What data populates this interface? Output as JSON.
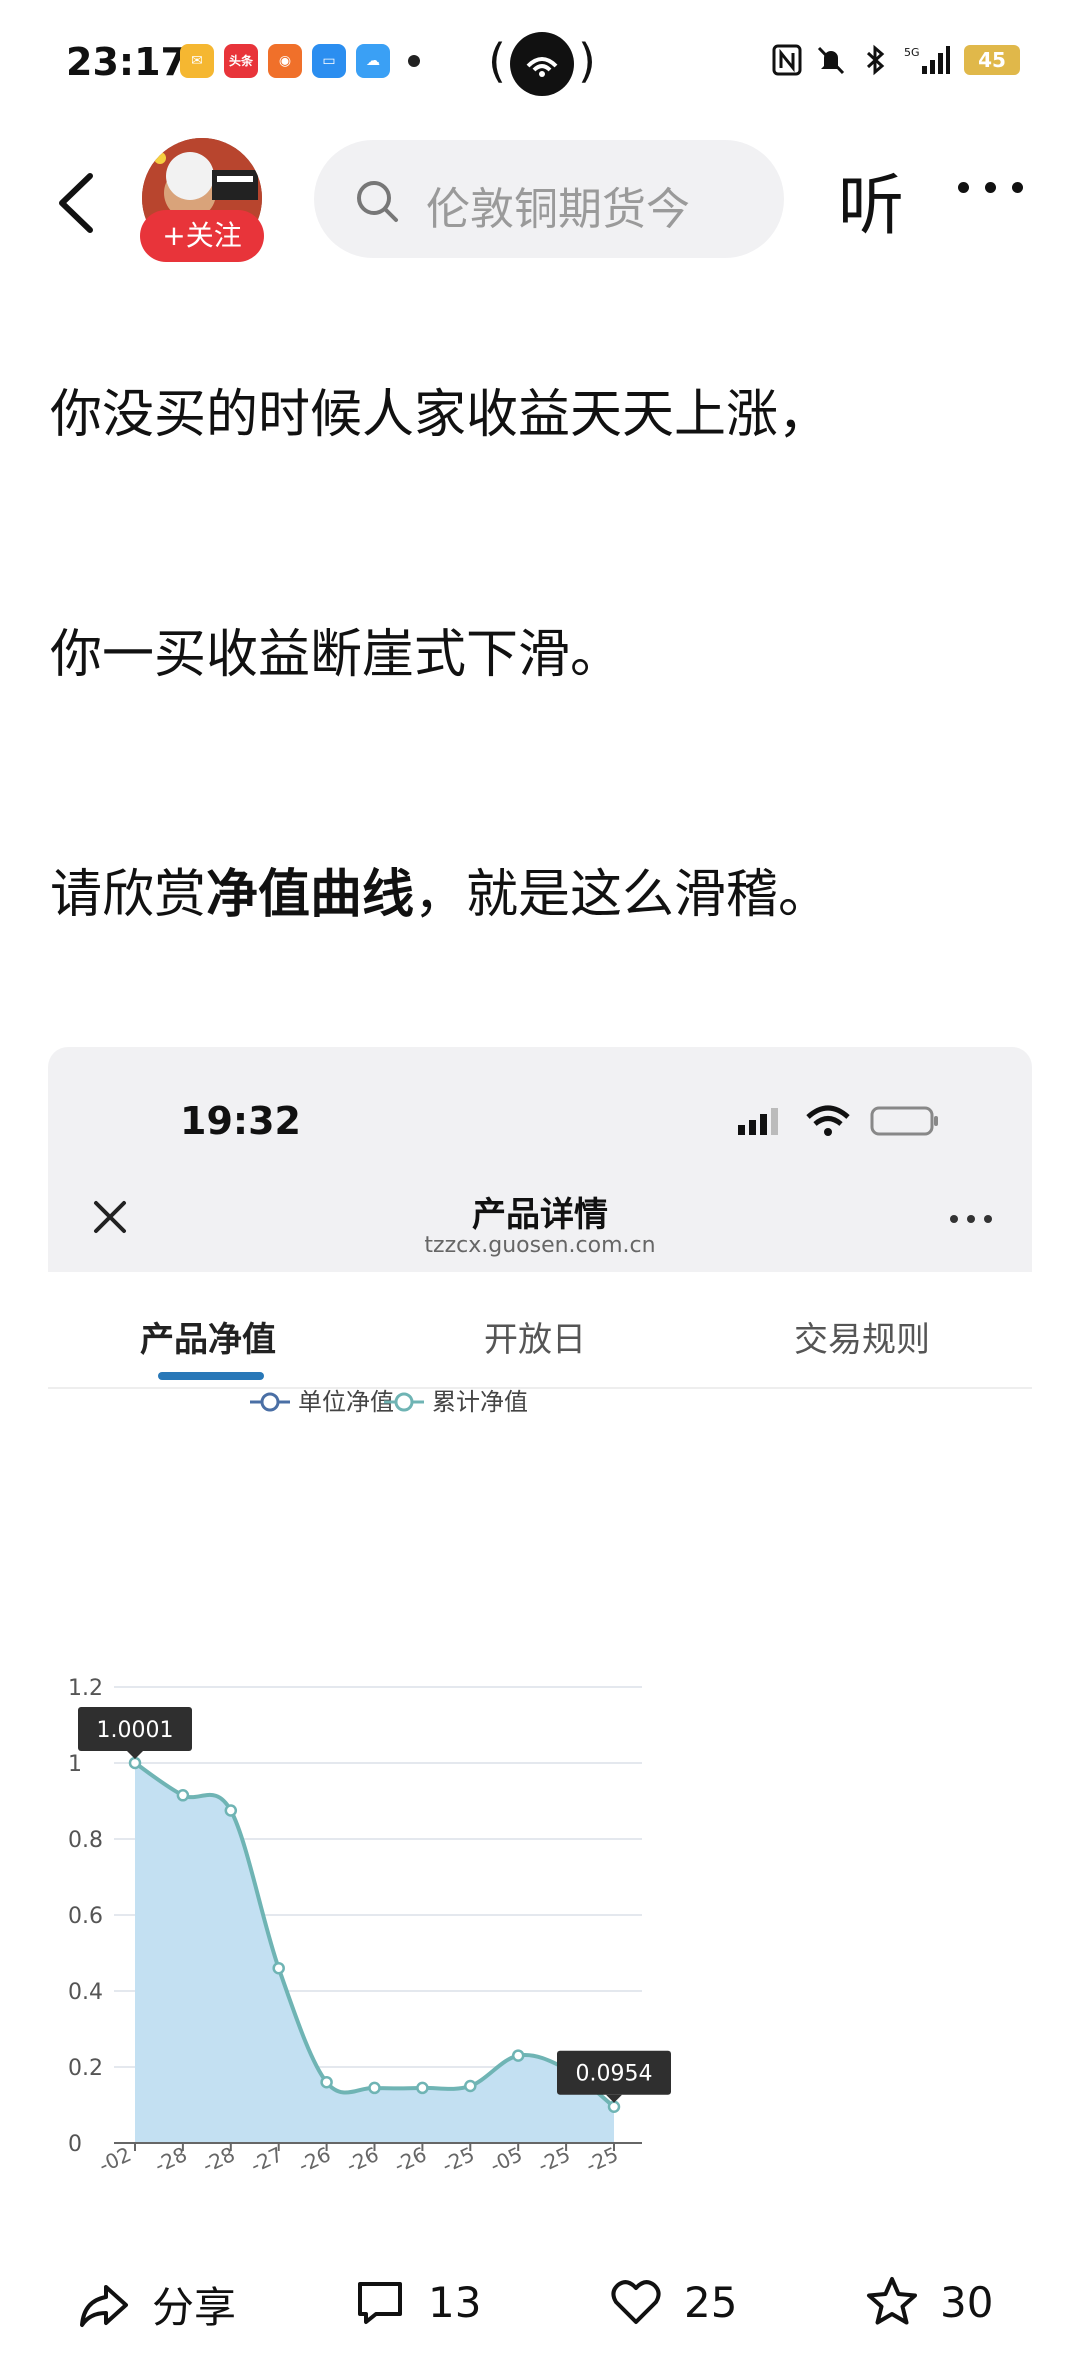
{
  "status_bar": {
    "time": "23:17",
    "app_icons": [
      {
        "name": "mail-app-icon",
        "color": "#f5b731",
        "label": "✉"
      },
      {
        "name": "toutiao-app-icon",
        "color": "#e8343a",
        "label": "头条"
      },
      {
        "name": "red-app-icon",
        "color": "#f0702a",
        "label": "◉"
      },
      {
        "name": "blue-app-icon",
        "color": "#2b8ef0",
        "label": "▭"
      },
      {
        "name": "weather-app-icon",
        "color": "#3aa0f5",
        "label": "☁"
      }
    ],
    "battery": "45"
  },
  "header": {
    "follow_label": "+关注",
    "search_placeholder": "伦敦铜期货今",
    "listen_label": "听"
  },
  "article": {
    "para1": "你没买的时候人家收益天天上涨，",
    "para2": "你一买收益断崖式下滑。",
    "para3_prefix": "请欣赏",
    "para3_bold": "净值曲线",
    "para3_suffix": "，就是这么滑稽。"
  },
  "embedded": {
    "time": "19:32",
    "title": "产品详情",
    "url": "tzzcx.guosen.com.cn",
    "tabs": [
      "产品净值",
      "开放日",
      "交易规则"
    ],
    "active_tab": 0
  },
  "chart_data": {
    "type": "area",
    "legend": [
      "单位净值",
      "累计净值"
    ],
    "legend_position": "top-center",
    "y_ticks": [
      "0",
      "0.2",
      "0.4",
      "0.6",
      "0.8",
      "1",
      "1.2"
    ],
    "ylim": [
      0,
      1.2
    ],
    "x_tick_labels": [
      "-02",
      "-28",
      "-28",
      "-27",
      "-26",
      "-26",
      "-26",
      "-25",
      "-05",
      "-25",
      "-25"
    ],
    "values": [
      1.0001,
      0.915,
      0.875,
      0.46,
      0.16,
      0.145,
      0.145,
      0.15,
      0.23,
      0.195,
      0.0954
    ],
    "annotations": [
      "1.0001",
      "0.0954"
    ],
    "grid": true,
    "colors": {
      "line": "#6fb4b4",
      "fill": "#c3e0f2",
      "legend_unit": "#4a6fa5",
      "legend_cum": "#6fb4b4"
    }
  },
  "actions": {
    "share_label": "分享",
    "comments": "13",
    "likes": "25",
    "favorites": "30"
  }
}
